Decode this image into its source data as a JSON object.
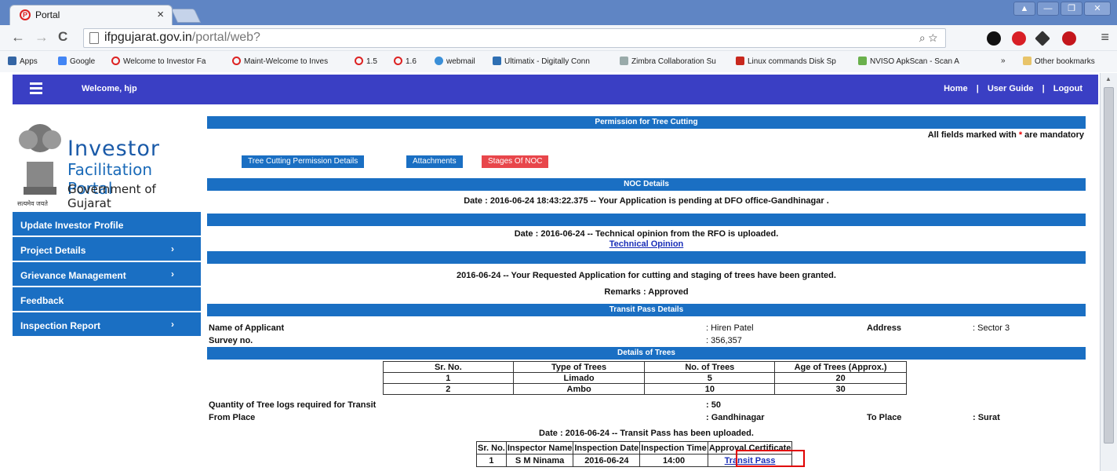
{
  "browser": {
    "tab_title": "Portal",
    "tab_close": "×",
    "url_host": "ifpgujarat.gov.in",
    "url_path": "/portal/web?",
    "window_controls": [
      "▲",
      "—",
      "❐",
      "✕"
    ],
    "nav": {
      "back": "←",
      "forward": "→",
      "reload": "C"
    },
    "bookmarks": [
      {
        "label": "Apps"
      },
      {
        "label": "Google"
      },
      {
        "label": "Welcome to Investor Fa"
      },
      {
        "label": "Maint-Welcome to Inves"
      },
      {
        "label": "1.5"
      },
      {
        "label": "1.6"
      },
      {
        "label": "webmail"
      },
      {
        "label": "Ultimatix - Digitally Conn"
      },
      {
        "label": "Zimbra Collaboration Su"
      },
      {
        "label": "Linux commands Disk Sp"
      },
      {
        "label": "NVISO ApkScan - Scan A"
      },
      {
        "label": "»"
      },
      {
        "label": "Other bookmarks"
      }
    ]
  },
  "header": {
    "welcome": "Welcome, hjp",
    "links": {
      "home": "Home",
      "guide": "User Guide",
      "logout": "Logout",
      "sep": "|"
    }
  },
  "logo": {
    "line1": "Investor",
    "line2": "Facilitation Portal",
    "line3": "Government of Gujarat",
    "motto": "सत्यमेव जयते"
  },
  "sidebar": {
    "items": [
      {
        "label": "Update Investor Profile",
        "chev": ""
      },
      {
        "label": "Project Details",
        "chev": "›"
      },
      {
        "label": "Grievance Management",
        "chev": "›"
      },
      {
        "label": "Feedback",
        "chev": ""
      },
      {
        "label": "Inspection Report",
        "chev": "›"
      }
    ]
  },
  "main": {
    "title": "Permission for Tree Cutting",
    "mandatory_prefix": "All fields marked with ",
    "mandatory_star": "*",
    "mandatory_suffix": " are mandatory",
    "tabs": {
      "details": "Tree Cutting Permission Details",
      "attachments": "Attachments",
      "stages": "Stages Of NOC"
    },
    "noc_header": "NOC Details",
    "noc1": "Date : 2016-06-24 18:43:22.375   --   Your Application is pending at DFO office-Gandhinagar .",
    "noc2": "Date : 2016-06-24   --   Technical opinion from the RFO is uploaded.",
    "noc2_link": "Technical Opinion",
    "noc3": "2016-06-24   --   Your Requested Application for cutting and staging of trees have been granted.",
    "remarks": "Remarks : Approved",
    "transit_header": "Transit Pass Details",
    "applicant_label": "Name of Applicant",
    "applicant_value": ": Hiren Patel",
    "address_label": "Address",
    "address_value": ": Sector 3",
    "survey_label": "Survey no.",
    "survey_value": ": 356,357",
    "trees_header": "Details of Trees",
    "trees_columns": [
      "Sr. No.",
      "Type of Trees",
      "No. of Trees",
      "Age of Trees (Approx.)"
    ],
    "trees_rows": [
      [
        "1",
        "Limado",
        "5",
        "20"
      ],
      [
        "2",
        "Ambo",
        "10",
        "30"
      ]
    ],
    "qty_label": "Quantity of Tree logs required for Transit",
    "qty_value": ": 50",
    "from_label": "From Place",
    "from_value": ": Gandhinagar",
    "to_label": "To Place",
    "to_value": ": Surat",
    "transit_status": "Date : 2016-06-24   --   Transit Pass has been uploaded.",
    "insp_columns": [
      "Sr. No.",
      "Inspector Name",
      "Inspection Date",
      "Inspection Time",
      "Approval Certificate"
    ],
    "insp_row": [
      "1",
      "S M Ninama",
      "2016-06-24",
      "14:00"
    ],
    "insp_link": "Transit Pass"
  },
  "colors": {
    "portal_bar": "#3a3fc4",
    "sidebar": "#1a6fc3",
    "stages_tab": "#e8464b",
    "highlight": "#e00000"
  }
}
